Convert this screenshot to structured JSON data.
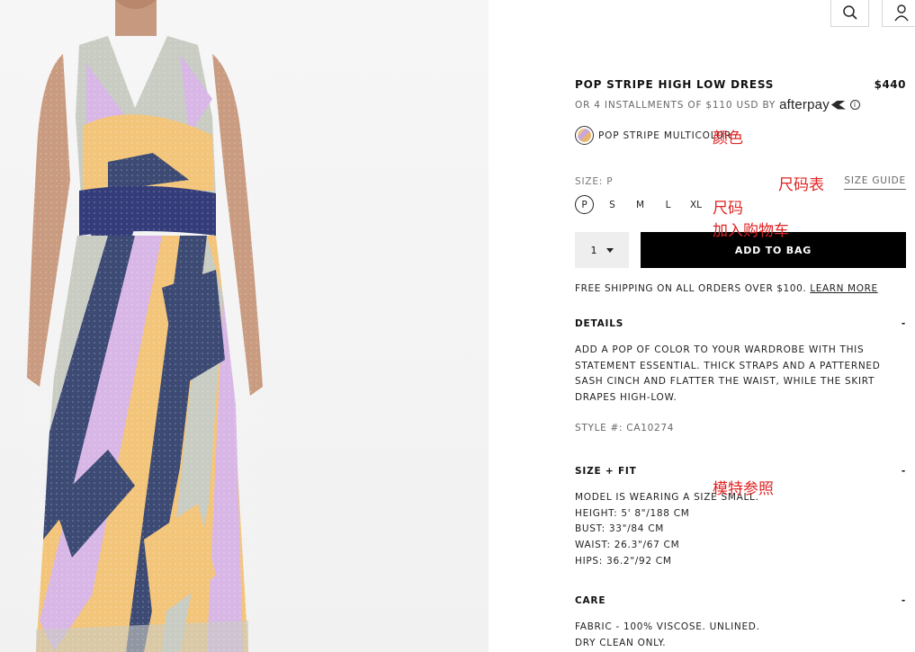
{
  "header": {
    "search_icon": "search-icon",
    "account_icon": "user-icon"
  },
  "product": {
    "title": "POP STRIPE HIGH LOW DRESS",
    "price": "$440",
    "installments": "OR 4 INSTALLMENTS OF $110 USD BY",
    "afterpay_logo": "afterpay",
    "info_icon": "i",
    "color_name": "POP STRIPE MULTICOLOR",
    "size_label": "SIZE: P",
    "size_guide": "SIZE GUIDE",
    "sizes": [
      "P",
      "S",
      "M",
      "L",
      "XL"
    ],
    "selected_size": "P",
    "quantity": "1",
    "add_to_bag": "ADD TO BAG",
    "shipping_text": "FREE SHIPPING ON ALL ORDERS OVER $100.",
    "learn_more": "LEARN MORE"
  },
  "sections": {
    "details": {
      "title": "DETAILS",
      "toggle": "-",
      "lines": [
        "ADD A POP OF COLOR TO YOUR WARDROBE WITH THIS",
        "STATEMENT ESSENTIAL. THICK STRAPS AND A PATTERNED",
        "SASH CINCH AND FLATTER THE WAIST, WHILE THE SKIRT",
        "DRAPES HIGH-LOW."
      ],
      "style_number": "STYLE #: CA10274"
    },
    "size_fit": {
      "title": "SIZE + FIT",
      "toggle": "-",
      "lines": [
        "MODEL IS WEARING A SIZE SMALL.",
        "HEIGHT: 5' 8\"/188 CM",
        "BUST: 33\"/84 CM",
        "WAIST: 26.3\"/67 CM",
        "HIPS: 36.2\"/92 CM"
      ]
    },
    "care": {
      "title": "CARE",
      "toggle": "-",
      "lines": [
        "FABRIC - 100% VISCOSE. UNLINED.",
        "DRY CLEAN ONLY."
      ]
    }
  },
  "annotations": {
    "color": "颜色",
    "size_chart": "尺码表",
    "size": "尺码",
    "add_to_cart": "加入购物车",
    "model_reference": "模特参照"
  },
  "colors": {
    "button_black": "#000000",
    "annotation_red": "#e02424",
    "qty_bg": "#eeeeee"
  }
}
